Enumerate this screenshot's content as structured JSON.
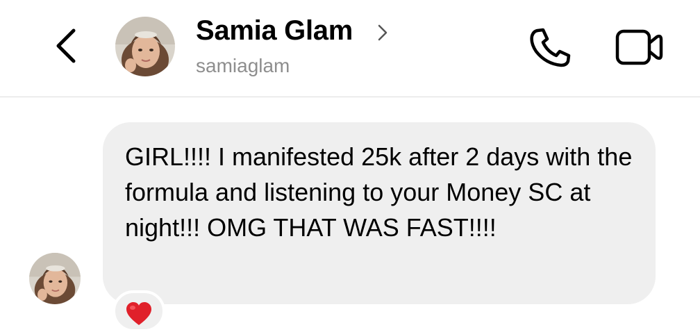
{
  "header": {
    "back_icon": "chevron-left-icon",
    "contact_name": "Samia Glam",
    "name_chevron_icon": "chevron-right-icon",
    "contact_handle": "samiaglam",
    "call_icon": "phone-icon",
    "video_icon": "video-camera-icon"
  },
  "message": {
    "text": "GIRL!!!! I manifested 25k after 2 days with the formula and listening to your Money SC at night!!! OMG THAT WAS FAST!!!!",
    "reaction_icon": "heart-icon",
    "bubble_color": "#efefef",
    "reaction_color": "#e0202a"
  },
  "colors": {
    "secondary_text": "#8e8e8e",
    "divider": "#dcdcdc"
  }
}
